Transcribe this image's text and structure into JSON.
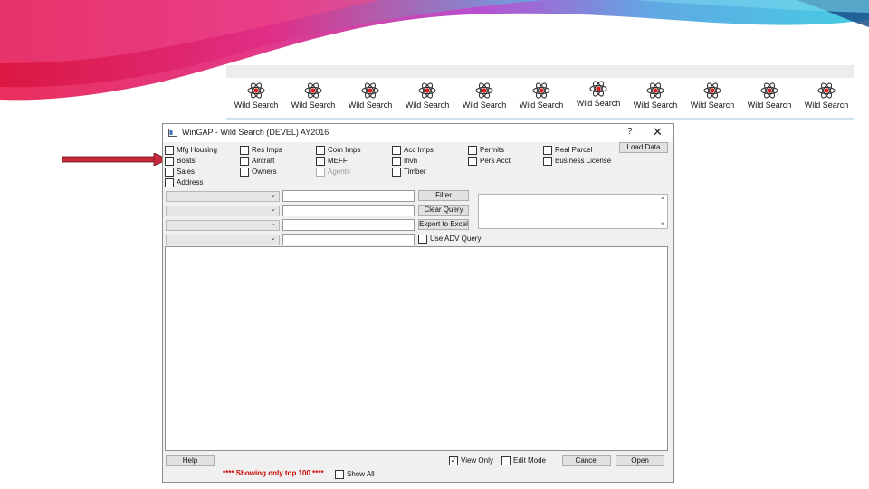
{
  "strip": {
    "item_label": "Wild Search",
    "icon": "atom-icon"
  },
  "window": {
    "title": "WinGAP - Wild Search (DEVEL) AY2016",
    "help_label": "?",
    "close_label": "✕",
    "load_data_label": "Load Data",
    "checkboxes": {
      "mfg_housing": "Mfg Housing",
      "res_imps": "Res Imps",
      "com_imps": "Com Imps",
      "acc_imps": "Acc Imps",
      "permits": "Permits",
      "real_parcel": "Real Parcel",
      "boats": "Boats",
      "aircraft": "Aircraft",
      "meff": "MEFF",
      "invn": "Invn",
      "pers_acct": "Pers Acct",
      "business_license": "Business License",
      "sales": "Sales",
      "owners": "Owners",
      "agents": "Agents",
      "timber": "Timber",
      "address": "Address"
    },
    "buttons": {
      "filter": "Filter",
      "clear_query": "Clear Query",
      "export": "Export to Excel",
      "help": "Help",
      "cancel": "Cancel",
      "open": "Open"
    },
    "use_adv_query": "Use ADV Query",
    "view_only": "View Only",
    "edit_mode": "Edit Mode",
    "showing_text": "**** Showing only top  100 ****",
    "show_all": "Show All"
  },
  "colors": {
    "accent": "#cc2a3b",
    "highlight": "#cfe3ef"
  }
}
